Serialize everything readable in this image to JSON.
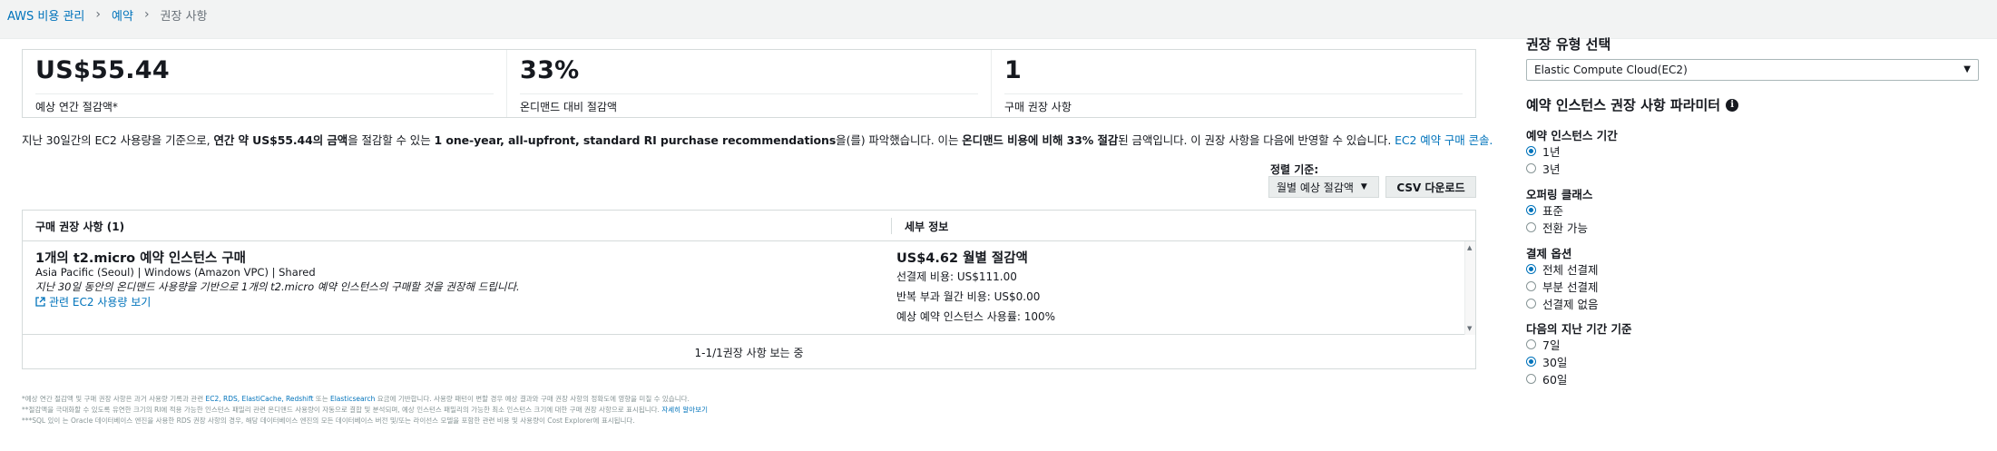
{
  "breadcrumb": {
    "items": [
      "AWS 비용 관리",
      "예약",
      "권장 사항"
    ]
  },
  "stats": [
    {
      "value": "US$55.44",
      "label": "예상 연간 절감액*"
    },
    {
      "value": "33%",
      "label": "온디맨드 대비 절감액"
    },
    {
      "value": "1",
      "label": "구매 권장 사항"
    }
  ],
  "summary": {
    "p1": "지난 30일간의 EC2 사용량을 기준으로, ",
    "b1": "연간 약 US$55.44의 금액",
    "p2": "을 절감할 수 있는 ",
    "b2": "1 one-year, all-upfront, standard RI purchase recommendations",
    "p3": "을(를) 파악했습니다. 이는 ",
    "b3": "온디맨드 비용에 비해 33% 절감",
    "p4": "된 금액입니다. 이 권장 사항을 다음에 반영할 수 있습니다. ",
    "link": "EC2 예약 구매 콘솔."
  },
  "sort": {
    "label": "정렬 기준:",
    "selected": "월별 예상 절감액",
    "caret_icon": "caret-down-icon"
  },
  "csv_button": "CSV 다운로드",
  "table": {
    "col1": "구매 권장 사항 (1)",
    "col2": "세부 정보",
    "row": {
      "title": "1개의 t2.micro 예약 인스턴스 구매",
      "subtitle": "Asia Pacific (Seoul) | Windows (Amazon VPC) | Shared",
      "description": "지난 30일 동안의 온디맨드 사용량을 기반으로 1개의 t2.micro 예약 인스턴스의 구매할 것을 권장해 드립니다.",
      "link": "관련 EC2 사용량 보기",
      "savings": "US$4.62 월별 절감액",
      "upfront": "선결제 비용:  US$111.00",
      "recurring": "반복 부과 월간 비용:  US$0.00",
      "utilization": "예상 예약 인스턴스 사용률:  100%"
    },
    "pager": "1-1/1권장 사항 보는 중"
  },
  "footnotes": {
    "line1_a": "*예상 연간 절감액 및 구매 권장 사항은 과거 사용량 기록과 관련 ",
    "line1_links": "EC2, RDS, ElastiCache, Redshift",
    "line1_b": " 또는 ",
    "line1_link2": "Elasticsearch",
    "line1_c": " 요금에 기반합니다. 사용량 패턴이 변할 경우 예상 결과와 구매 권장 사항의 정확도에 영향을 미칠 수 있습니다.",
    "line2_a": "**절감액을 극대화할 수 있도록 유연한 크기의 RI에 적용 가능한 인스턴스 패밀리 관련 온디맨드 사용량이 자동으로 결합 및 분석되며, 예상 인스턴스 패밀리의 가능한 최소 인스턴스 크기에 대한 구매 권장 사항으로 표시됩니다. ",
    "line2_link": "자세히 알아보기",
    "line3": "***SQL 있이 는 Oracle 데이터베이스 엔진을 사용한 RDS 권장 사항의 경우, 해당 데이터베이스 엔진의 모든 데이터베이스 버전 및/또는 라이선스 모델을 포함한 관련 비용 및 사용량이 Cost Explorer에 표시됩니다."
  },
  "panel": {
    "type_heading": "권장 유형 선택",
    "type_selected": "Elastic Compute Cloud(EC2)",
    "params_heading": "예약 인스턴스 권장 사항 파라미터",
    "info_icon": "info-icon",
    "term": {
      "label": "예약 인스턴스 기간",
      "options": [
        "1년",
        "3년"
      ],
      "selected": "1년"
    },
    "offering": {
      "label": "오퍼링 클래스",
      "options": [
        "표준",
        "전환 가능"
      ],
      "selected": "표준"
    },
    "payment": {
      "label": "결제 옵션",
      "options": [
        "전체 선결제",
        "부분 선결제",
        "선결제 없음"
      ],
      "selected": "전체 선결제"
    },
    "lookback": {
      "label": "다음의 지난 기간 기준",
      "options": [
        "7일",
        "30일",
        "60일"
      ],
      "selected": "30일"
    }
  }
}
